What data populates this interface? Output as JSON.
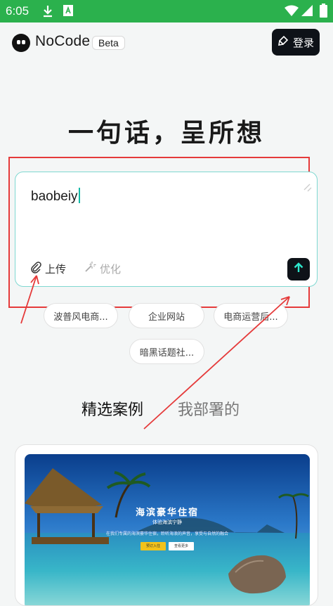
{
  "status_bar": {
    "time": "6:05"
  },
  "header": {
    "brand": "NoCode",
    "beta_badge": "Beta",
    "login_label": "登录"
  },
  "hero": {
    "title": "一句话，呈所想"
  },
  "prompt_card": {
    "input_value": "baobeiy",
    "upload_label": "上传",
    "optimize_label": "优化"
  },
  "suggestions": [
    "波普风电商...",
    "企业网站",
    "电商运营后...",
    "暗黑话题社..."
  ],
  "tabs": {
    "featured": "精选案例",
    "deployed": "我部署的"
  },
  "showcase": {
    "title": "海滨豪华住宿",
    "subtitle": "体验海滨宁静",
    "description": "在我们专属的海滨豪华住宿，聆听海浪的声音，享受与自然的融合",
    "primary_button": "预订入住",
    "secondary_button": "查看更多"
  },
  "colors": {
    "status_bar": "#2bb14d",
    "accent": "#14b8a6",
    "annotation": "#e53a3a",
    "dark_button": "#0e1218"
  }
}
